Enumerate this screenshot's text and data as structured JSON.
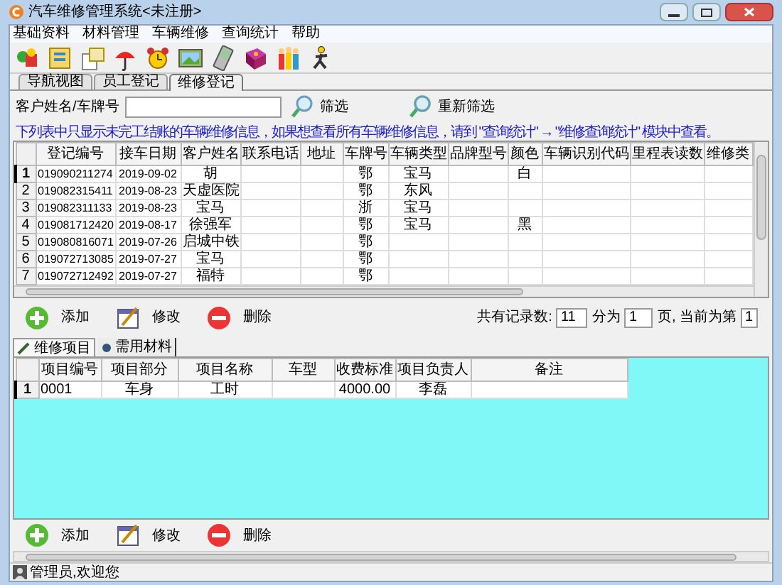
{
  "window": {
    "title": "汽车维修管理系统<未注册>"
  },
  "menu": [
    "基础资料",
    "材料管理",
    "车辆维修",
    "查询统计",
    "帮助"
  ],
  "tabs": [
    {
      "label": "导航视图",
      "selected": false
    },
    {
      "label": "员工登记",
      "selected": false
    },
    {
      "label": "维修登记",
      "selected": true
    }
  ],
  "search": {
    "label": "客户姓名/车牌号",
    "filter_button": "筛选",
    "refilter_button": "重新筛选"
  },
  "notice": "下列表中只显示未完工结账的车辆维修信息，如果想查看所有车辆维修信息，请到 \"查询统计\" → \"维修查询统计\" 模块中查看。",
  "repairs": {
    "columns": [
      "登记编号",
      "接车日期",
      "客户姓名",
      "联系电话",
      "地址",
      "车牌号",
      "车辆类型",
      "品牌型号",
      "颜色",
      "车辆识别代码",
      "里程表读数",
      "维修类"
    ],
    "rows": [
      {
        "num": "1",
        "selected": true,
        "cells": [
          "019090211274",
          "2019-09-02",
          "胡",
          "",
          "",
          "鄂",
          "宝马",
          "",
          "白",
          "",
          "",
          ""
        ]
      },
      {
        "num": "2",
        "selected": false,
        "cells": [
          "019082315411",
          "2019-08-23",
          "天虚医院",
          "",
          "",
          "鄂",
          "东风",
          "",
          "",
          "",
          "",
          ""
        ]
      },
      {
        "num": "3",
        "selected": false,
        "cells": [
          "019082311133",
          "2019-08-23",
          "宝马",
          "",
          "",
          "浙",
          "宝马",
          "",
          "",
          "",
          "",
          ""
        ]
      },
      {
        "num": "4",
        "selected": false,
        "cells": [
          "019081712420",
          "2019-08-17",
          "徐强军",
          "",
          "",
          "鄂",
          "宝马",
          "",
          "黑",
          "",
          "",
          ""
        ]
      },
      {
        "num": "5",
        "selected": false,
        "cells": [
          "019080816071",
          "2019-07-26",
          "启城中铁",
          "",
          "",
          "鄂",
          "",
          "",
          "",
          "",
          "",
          ""
        ]
      },
      {
        "num": "6",
        "selected": false,
        "cells": [
          "019072713085",
          "2019-07-27",
          "宝马",
          "",
          "",
          "鄂",
          "",
          "",
          "",
          "",
          "",
          ""
        ]
      },
      {
        "num": "7",
        "selected": false,
        "cells": [
          "019072712492",
          "2019-07-27",
          "福特",
          "",
          "",
          "鄂",
          "",
          "",
          "",
          "",
          "",
          ""
        ]
      }
    ]
  },
  "actions_top": [
    "添加",
    "修改",
    "删除"
  ],
  "paging": {
    "total_label": "共有记录数:",
    "total": "11",
    "pages_label": "分为",
    "pages": "1",
    "current_label": "页, 当前为第",
    "current": "1"
  },
  "subtabs": [
    {
      "label": "维修项目",
      "selected": true
    },
    {
      "label": "需用材料",
      "selected": false
    }
  ],
  "items": {
    "columns": [
      "项目编号",
      "项目部分",
      "项目名称",
      "车型",
      "收费标准",
      "项目负责人",
      "备注"
    ],
    "rows": [
      {
        "num": "1",
        "selected": true,
        "cells": [
          "0001",
          "车身",
          "工时",
          "",
          "4000.00",
          "李磊",
          ""
        ]
      }
    ]
  },
  "actions_bottom": [
    "添加",
    "修改",
    "删除"
  ],
  "status_bar": "管理员,欢迎您"
}
